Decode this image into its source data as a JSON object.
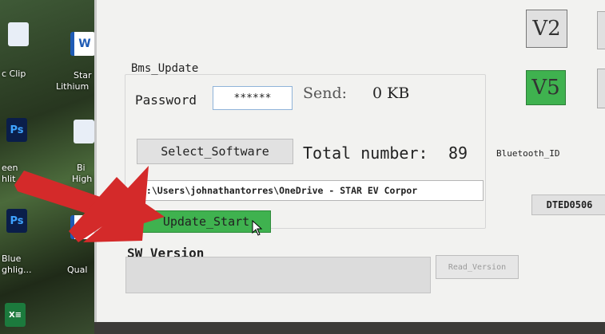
{
  "desktop": {
    "items": [
      {
        "label": "c Clip"
      },
      {
        "label": "Star"
      },
      {
        "label": "Lithium"
      },
      {
        "label": "een"
      },
      {
        "label": "hlit"
      },
      {
        "label": "High"
      },
      {
        "label": "Blue"
      },
      {
        "label": "ghlig..."
      },
      {
        "label": "Bi"
      },
      {
        "label": "Qual"
      }
    ]
  },
  "bms_update": {
    "group_title": "Bms_Update",
    "password_label": "Password",
    "password_value": "******",
    "send_label": "Send:",
    "send_value": "0 KB",
    "select_software_label": "Select_Software",
    "total_number_label": "Total number:",
    "total_number_value": "89",
    "bluetooth_id_label": "Bluetooth_ID",
    "path_value": "C:\\Users\\johnathantorres\\OneDrive - STAR EV Corpor",
    "update_start_label": "Update_Start",
    "device_id": "DTED0506"
  },
  "version_badges": {
    "v2": "V2",
    "v5": "V5"
  },
  "sw_version": {
    "label": "SW_Version",
    "value": "",
    "read_version_label": "Read_Version"
  },
  "colors": {
    "accent_green": "#3fb24f",
    "arrow_red": "#d42a2a"
  }
}
